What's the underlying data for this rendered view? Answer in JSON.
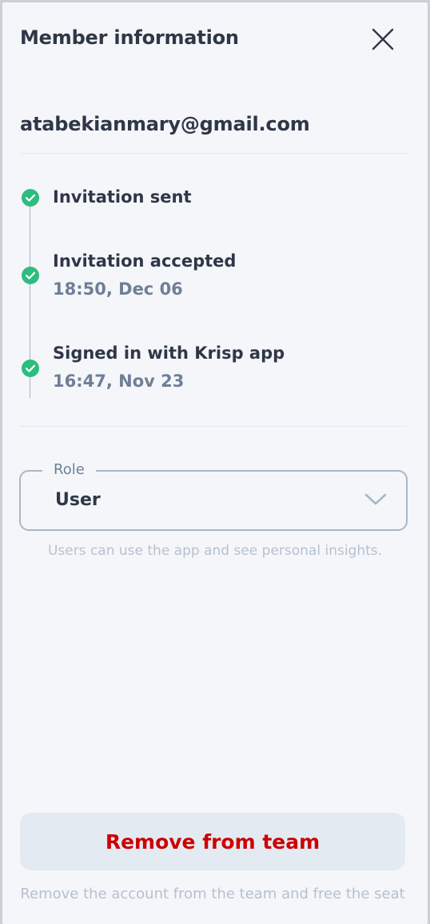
{
  "header": {
    "title": "Member information",
    "close_icon": "close-icon"
  },
  "member": {
    "email": "atabekianmary@gmail.com"
  },
  "timeline": {
    "steps": [
      {
        "title": "Invitation sent",
        "time": "",
        "status": "done",
        "icon": "check-circle-icon"
      },
      {
        "title": "Invitation accepted",
        "time": "18:50, Dec 06",
        "status": "done",
        "icon": "check-circle-icon"
      },
      {
        "title": "Signed in with Krisp app",
        "time": "16:47, Nov 23",
        "status": "done",
        "icon": "check-circle-icon"
      }
    ]
  },
  "role": {
    "label": "Role",
    "value": "User",
    "hint": "Users can use the app and see personal insights.",
    "icon": "chevron-down-icon"
  },
  "actions": {
    "remove_label": "Remove from team",
    "remove_hint": "Remove the account from the team and free the seat"
  },
  "colors": {
    "success": "#2dbd7e",
    "danger": "#cc0000",
    "text_primary": "#2f3747",
    "text_secondary": "#6f7f95",
    "text_muted": "#b6c1cf",
    "background": "#f4f6fa"
  }
}
